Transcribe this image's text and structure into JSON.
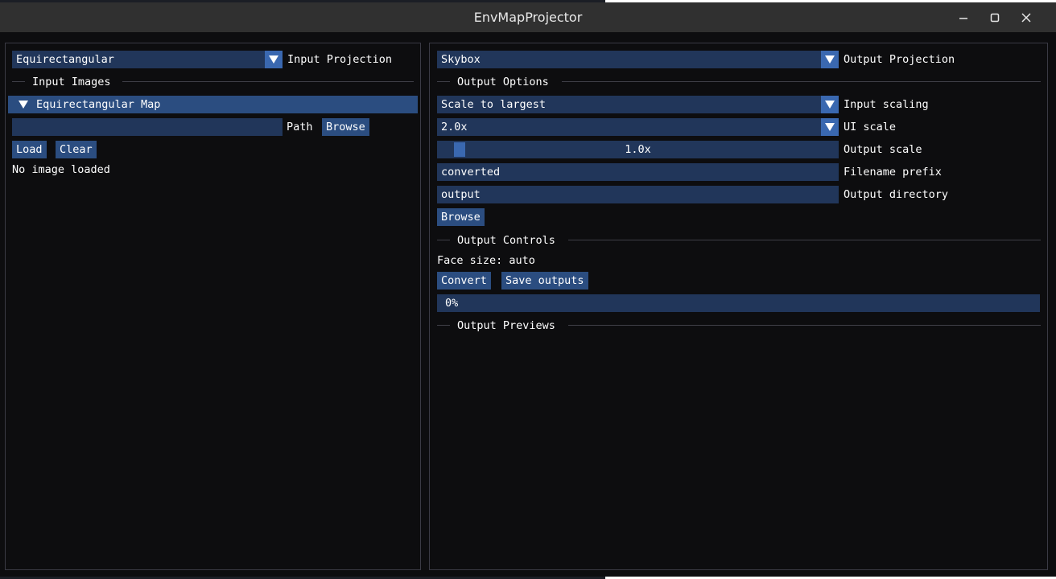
{
  "window": {
    "title": "EnvMapProjector"
  },
  "left": {
    "projection": {
      "value": "Equirectangular",
      "label": "Input Projection"
    },
    "input_images_header": "Input Images",
    "map_header": "Equirectangular Map",
    "path": {
      "value": "",
      "label": "Path",
      "browse_label": "Browse"
    },
    "load_label": "Load",
    "clear_label": "Clear",
    "status": "No image loaded"
  },
  "right": {
    "projection": {
      "value": "Skybox",
      "label": "Output Projection"
    },
    "output_options_header": "Output Options",
    "input_scaling": {
      "value": "Scale to largest",
      "label": "Input scaling"
    },
    "ui_scale": {
      "value": "2.0x",
      "label": "UI scale"
    },
    "output_scale": {
      "value": "1.0x",
      "label": "Output scale",
      "level": 0.04
    },
    "filename_prefix": {
      "value": "converted",
      "label": "Filename prefix"
    },
    "output_directory": {
      "value": "output",
      "label": "Output directory"
    },
    "browse_label": "Browse",
    "output_controls_header": "Output Controls",
    "face_size": "Face size: auto",
    "convert_label": "Convert",
    "save_outputs_label": "Save outputs",
    "progress": {
      "text": "0%",
      "fraction": 0.0
    },
    "output_previews_header": "Output Previews"
  },
  "colors": {
    "frame_bg": "#21365a",
    "button": "#2b4d80",
    "accent": "#3a68b0",
    "window_bg": "#0d0d0f"
  }
}
